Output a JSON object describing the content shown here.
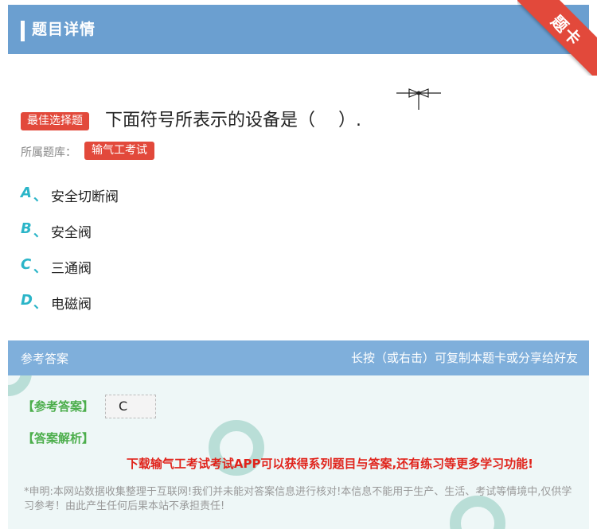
{
  "header": {
    "title": "题目详情"
  },
  "ribbon": {
    "label": "题卡"
  },
  "question": {
    "tag": "最佳选择题",
    "text": "下面符号所表示的设备是（　 ）.",
    "symbol_icon": "valve-symbol-icon"
  },
  "bank": {
    "label": "所属题库：",
    "name": "输气工考试"
  },
  "options": [
    {
      "letter": "A",
      "sep": "、",
      "text": "安全切断阀"
    },
    {
      "letter": "B",
      "sep": "、",
      "text": "安全阀"
    },
    {
      "letter": "C",
      "sep": "、",
      "text": "三通阀"
    },
    {
      "letter": "D",
      "sep": "、",
      "text": "电磁阀"
    }
  ],
  "answer": {
    "header_left": "参考答案",
    "header_right": "长按（或右击）可复制本题卡或分享给好友",
    "answer_label": "【参考答案】",
    "answer_value": "C",
    "analysis_label": "【答案解析】",
    "promo": "下载输气工考试考试APP可以获得系列题目与答案,还有练习等更多学习功能!",
    "disclaimer": "*申明:本网站数据收集整理于互联网!我们并未能对答案信息进行核对!本信息不能用于生产、生活、考试等情境中,仅供学习参考！由此产生任何后果本站不承担责任!"
  },
  "colors": {
    "header": "#6b9fd0",
    "accent_red": "#e2493b",
    "option_letter": "#2bb5c8",
    "answer_green": "#4cae4c",
    "promo_red": "#e0231b"
  }
}
